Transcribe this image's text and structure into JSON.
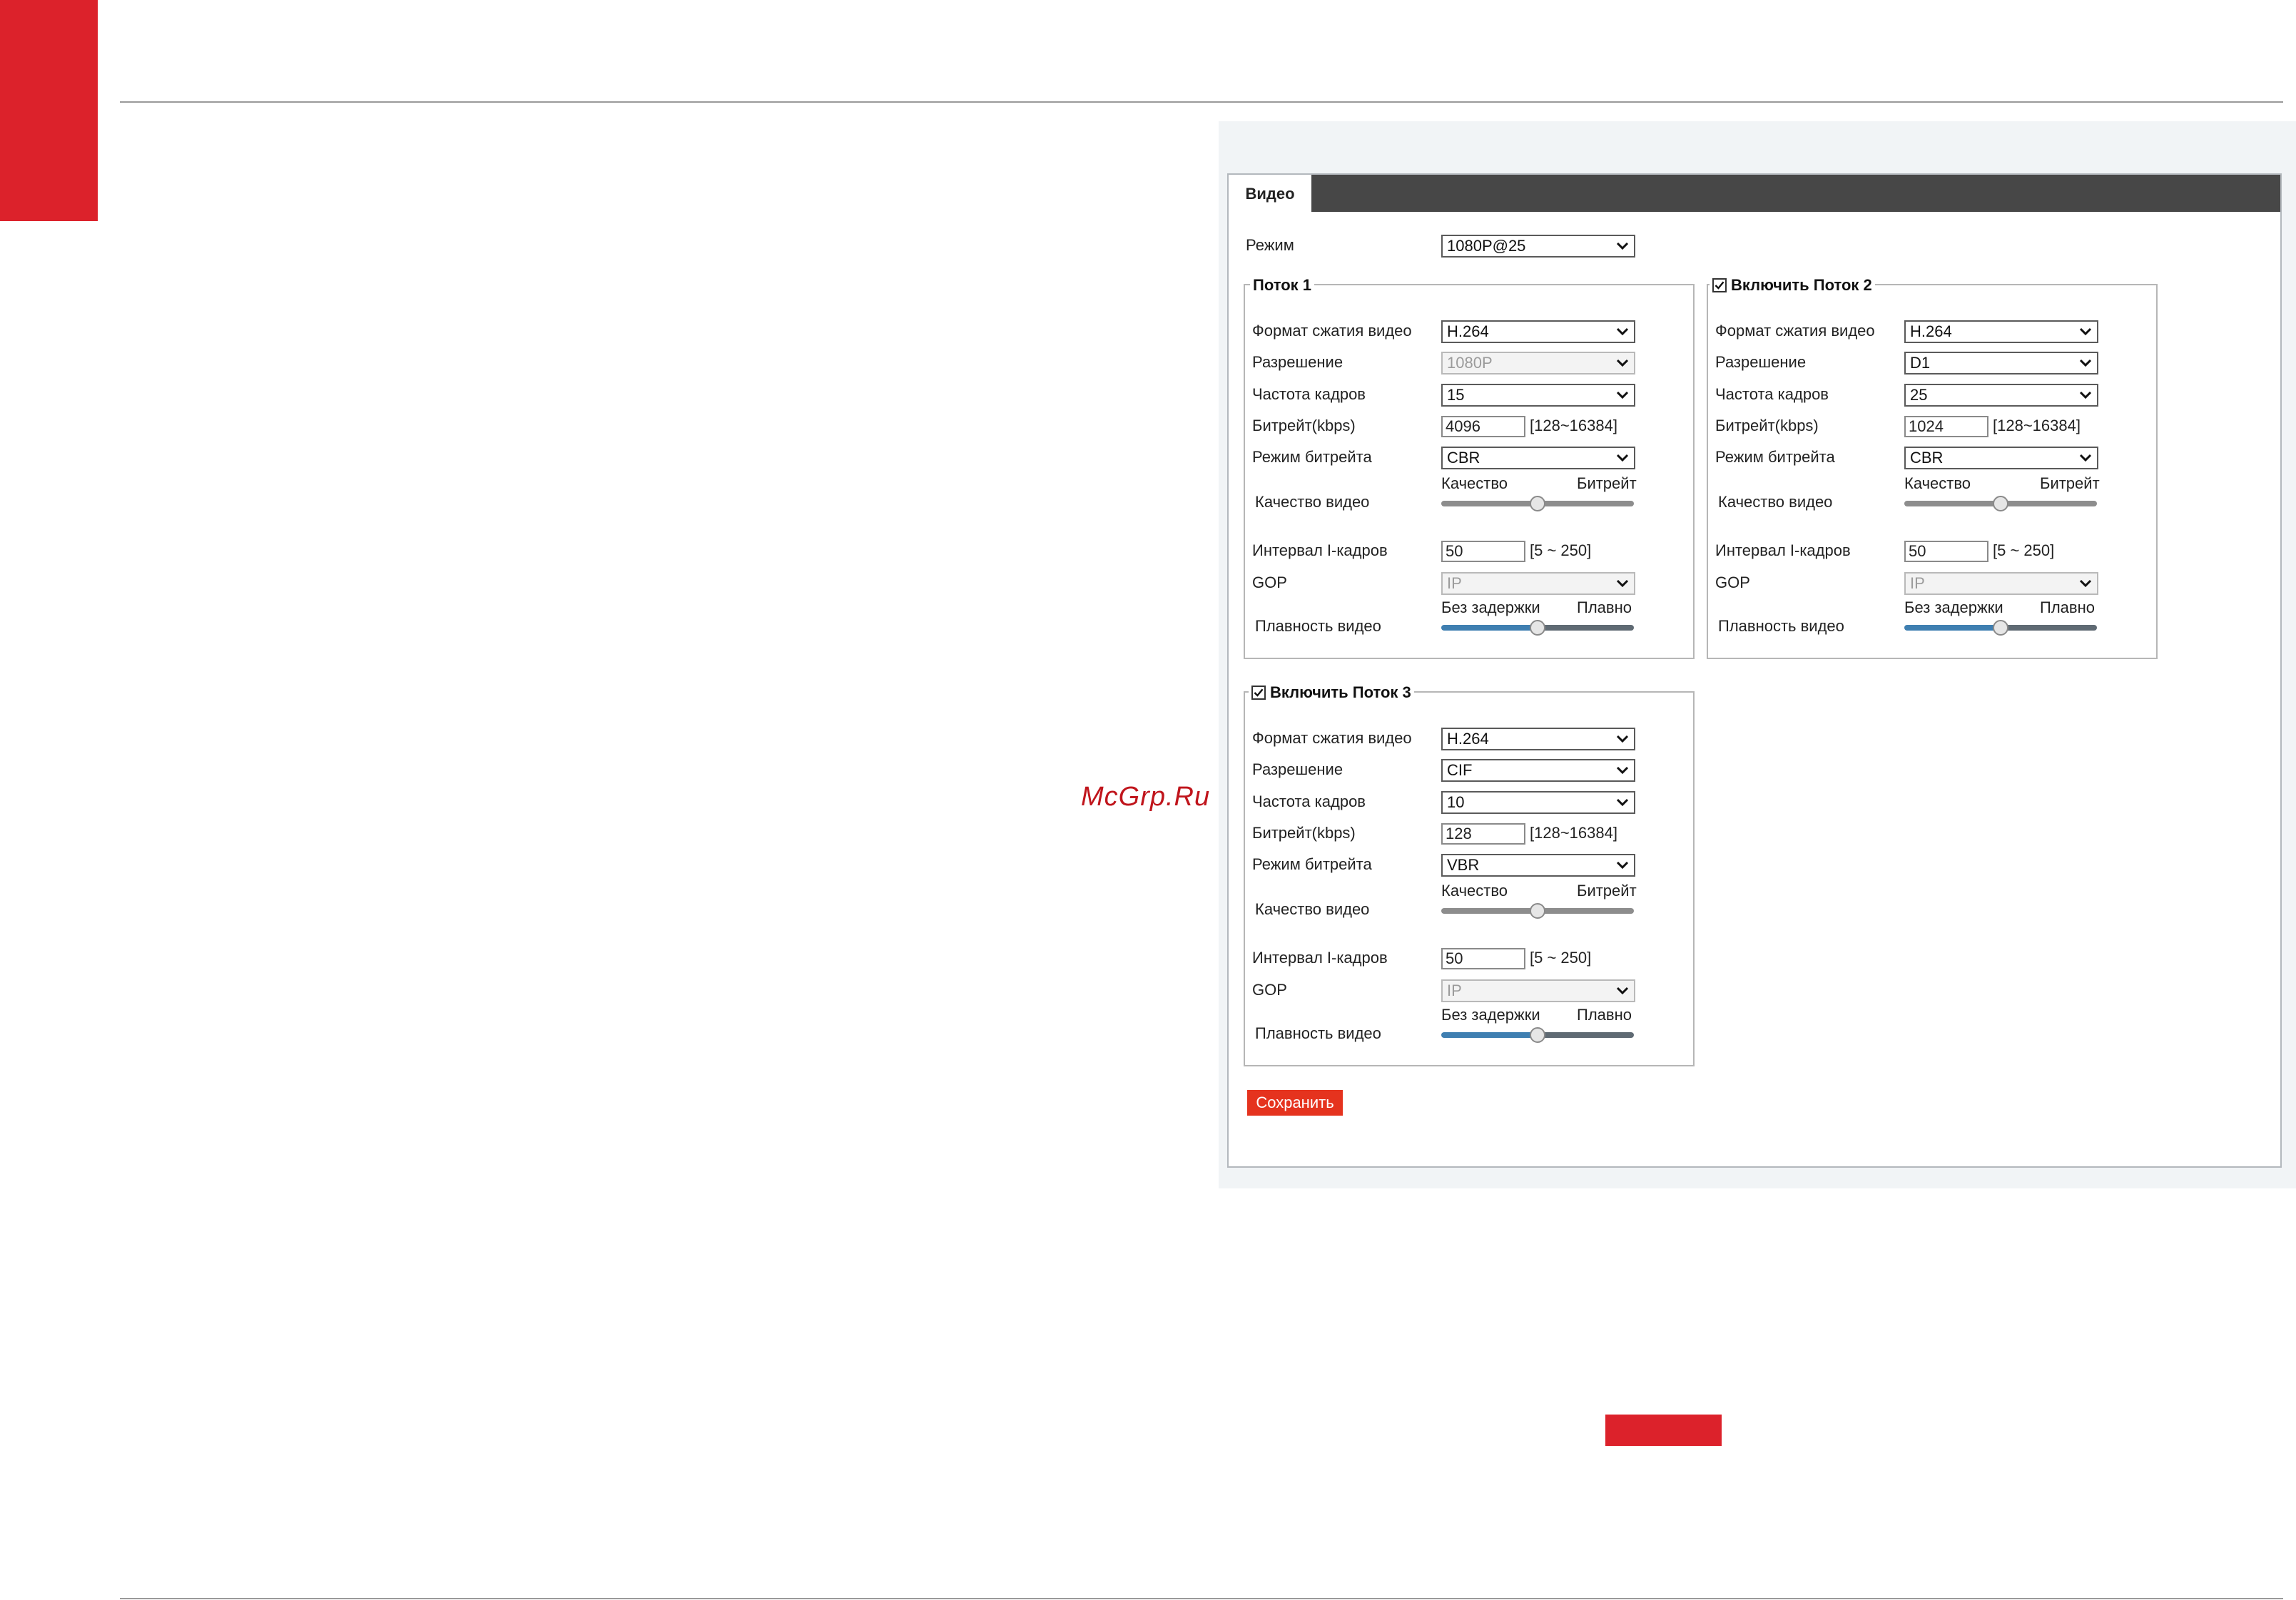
{
  "watermark": "McGrp.Ru",
  "tab": {
    "label": "Видео"
  },
  "mode": {
    "label": "Режим",
    "value": "1080P@25"
  },
  "labels": {
    "codec": "Формат сжатия видео",
    "resolution": "Разрешение",
    "framerate": "Частота кадров",
    "bitrate": "Битрейт(kbps)",
    "bitrate_mode": "Режим битрейта",
    "video_quality": "Качество видео",
    "quality_left": "Качество",
    "quality_right": "Битрейт",
    "iframe_interval": "Интервал I-кадров",
    "gop": "GOP",
    "smoothness": "Плавность видео",
    "smooth_left": "Без задержки",
    "smooth_right": "Плавно"
  },
  "streams": [
    {
      "title": "Поток 1",
      "checkbox": false,
      "codec": "H.264",
      "resolution": "1080P",
      "resolution_disabled": true,
      "framerate": "15",
      "bitrate": "4096",
      "bitrate_range": "[128~16384]",
      "bitrate_mode": "CBR",
      "quality_level": 0.5,
      "iframe": "50",
      "iframe_range": "[5 ~ 250]",
      "gop": "IP",
      "smooth_level": 0.5
    },
    {
      "title": "Включить Поток 2",
      "checkbox": true,
      "codec": "H.264",
      "resolution": "D1",
      "resolution_disabled": false,
      "framerate": "25",
      "bitrate": "1024",
      "bitrate_range": "[128~16384]",
      "bitrate_mode": "CBR",
      "quality_level": 0.5,
      "iframe": "50",
      "iframe_range": "[5 ~ 250]",
      "gop": "IP",
      "smooth_level": 0.5
    },
    {
      "title": "Включить Поток 3",
      "checkbox": true,
      "codec": "H.264",
      "resolution": "CIF",
      "resolution_disabled": false,
      "framerate": "10",
      "bitrate": "128",
      "bitrate_range": "[128~16384]",
      "bitrate_mode": "VBR",
      "quality_level": 0.5,
      "iframe": "50",
      "iframe_range": "[5 ~ 250]",
      "gop": "IP",
      "smooth_level": 0.5
    }
  ],
  "save_label": "Сохранить",
  "colors": {
    "accent_red": "#dc222b",
    "button_red": "#e5331e",
    "tabbar": "#474747",
    "slider_blue": "#3f7fb1"
  },
  "icons": {
    "dropdown": "chevron-down-icon",
    "checkbox": "checkmark-icon",
    "slider": "slider-knob"
  }
}
